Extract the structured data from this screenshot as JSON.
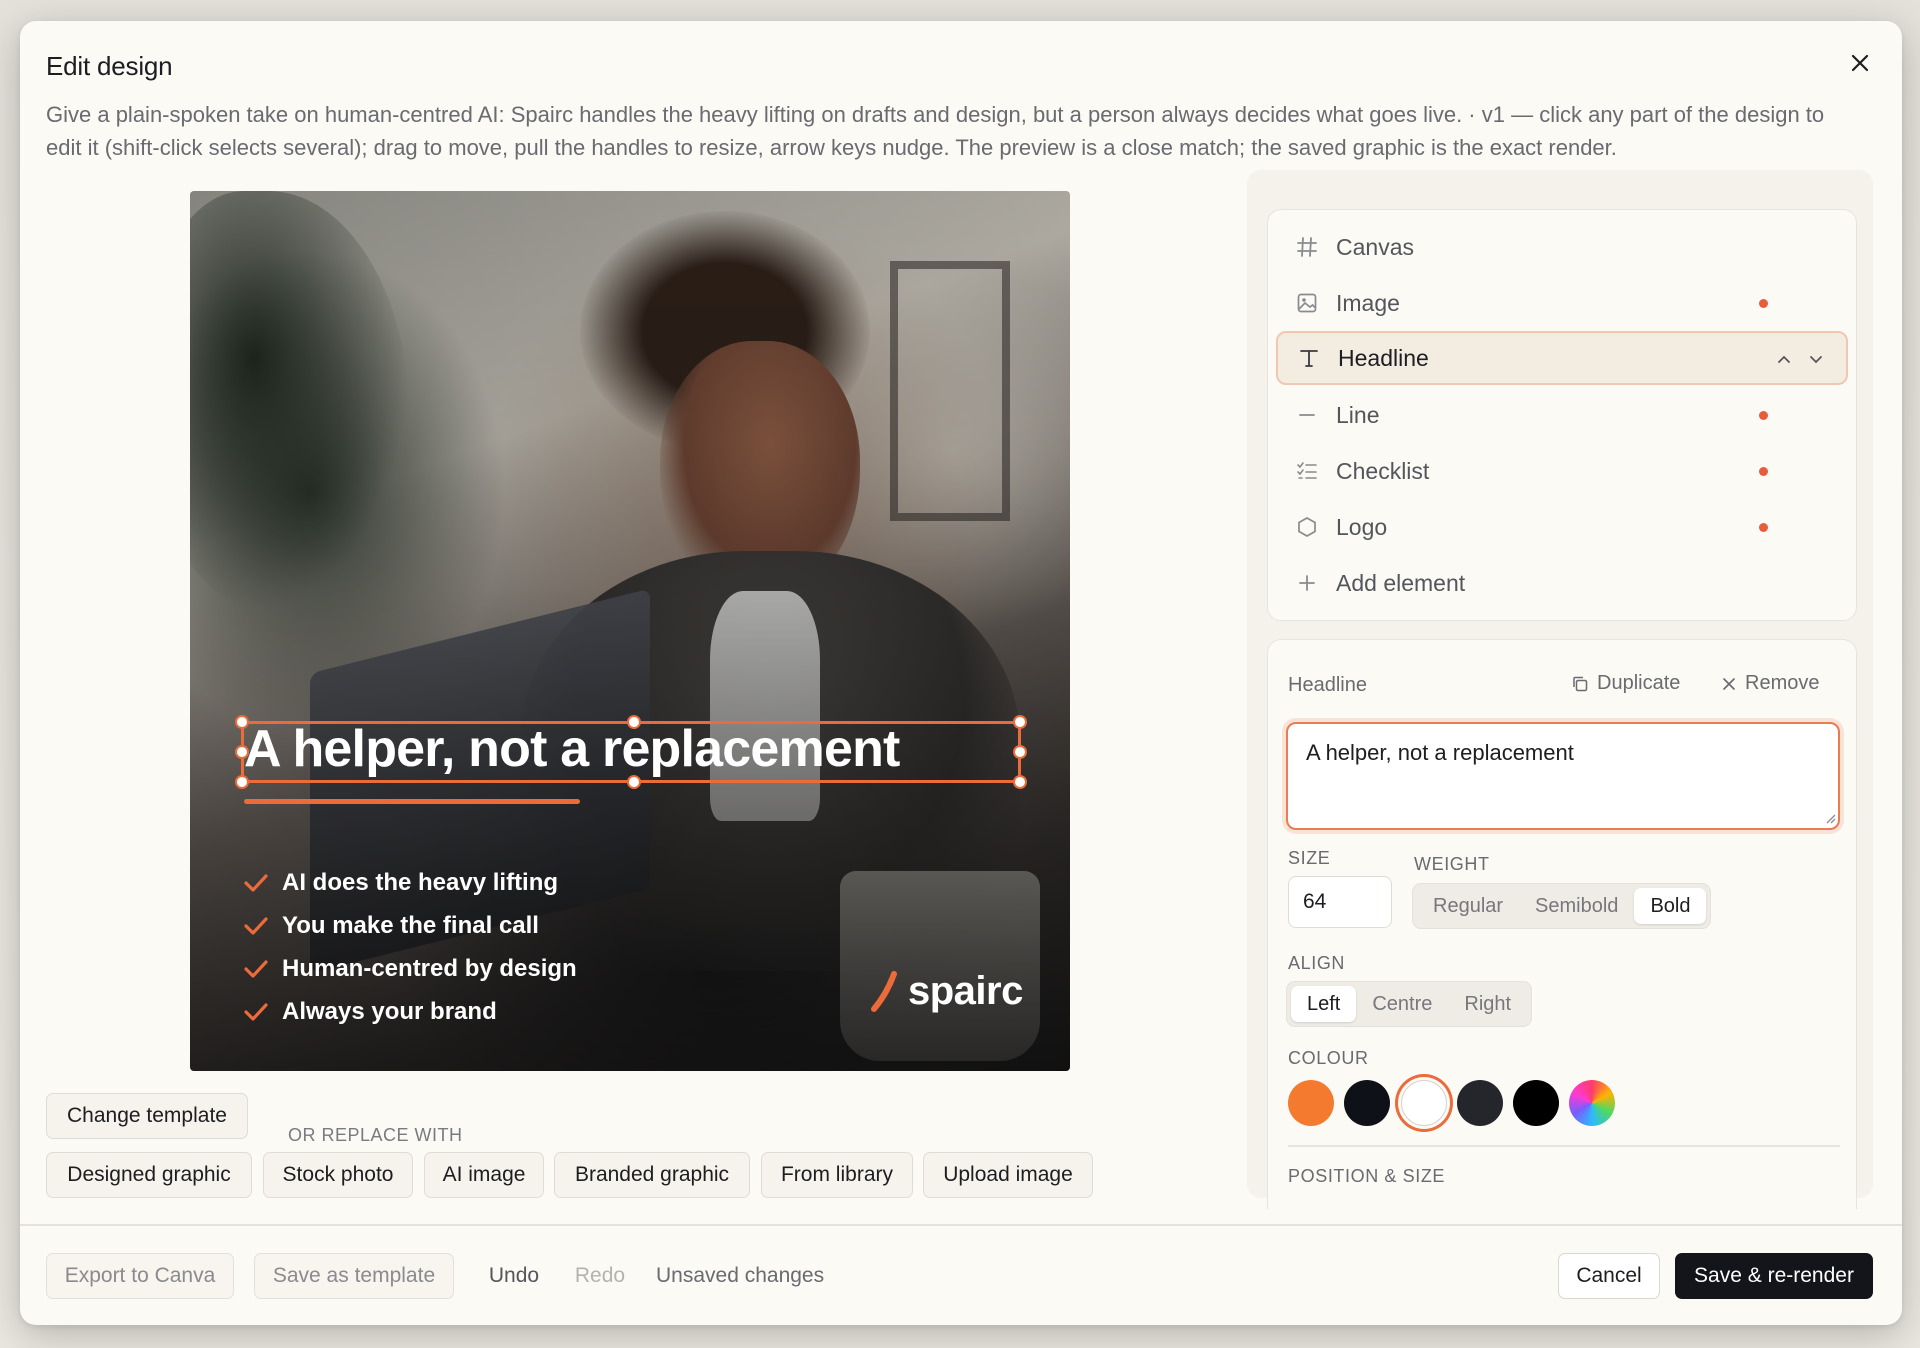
{
  "modal": {
    "title": "Edit design",
    "subtitle": "Give a plain-spoken take on human-centred AI: Spairc handles the heavy lifting on drafts and design, but a person always decides what goes live. · v1 — click any part of the design to edit it (shift-click selects several); drag to move, pull the handles to resize, arrow keys nudge. The preview is a close match; the saved graphic is the exact render."
  },
  "preview": {
    "headline": "A helper, not a replacement",
    "checklist": [
      "AI does the heavy lifting",
      "You make the final call",
      "Human-centred by design",
      "Always your brand"
    ],
    "brand": "spairc",
    "accent": "#ec6b3b"
  },
  "actions": {
    "change_template": "Change template",
    "or_replace_with": "OR REPLACE WITH",
    "replace_options": [
      "Designed graphic",
      "Stock photo",
      "AI image",
      "Branded graphic",
      "From library",
      "Upload image"
    ]
  },
  "layers": [
    {
      "label": "Canvas",
      "icon": "hash-icon",
      "dot": false
    },
    {
      "label": "Image",
      "icon": "image-icon",
      "dot": true
    },
    {
      "label": "Headline",
      "icon": "text-icon",
      "dot": false,
      "selected": true
    },
    {
      "label": "Line",
      "icon": "minus-icon",
      "dot": true
    },
    {
      "label": "Checklist",
      "icon": "list-check-icon",
      "dot": true
    },
    {
      "label": "Logo",
      "icon": "hexagon-icon",
      "dot": true
    },
    {
      "label": "Add element",
      "icon": "plus-icon",
      "dot": false
    }
  ],
  "props": {
    "title": "Headline",
    "duplicate_label": "Duplicate",
    "remove_label": "Remove",
    "text_value": "A helper, not a replacement",
    "size_label": "SIZE",
    "size_value": "64",
    "weight_label": "WEIGHT",
    "weights": [
      "Regular",
      "Semibold",
      "Bold"
    ],
    "weight_selected": "Bold",
    "align_label": "ALIGN",
    "aligns": [
      "Left",
      "Centre",
      "Right"
    ],
    "align_selected": "Left",
    "colour_label": "COLOUR",
    "colours": [
      "#f47a30",
      "#0f1119",
      "#ffffff",
      "#24262b",
      "#000000",
      "rainbow"
    ],
    "colour_selected": "#ffffff",
    "position_label": "POSITION & SIZE"
  },
  "footer": {
    "export_canva": "Export to Canva",
    "save_template": "Save as template",
    "undo": "Undo",
    "redo": "Redo",
    "status": "Unsaved changes",
    "cancel": "Cancel",
    "save_rerender": "Save & re-render"
  }
}
